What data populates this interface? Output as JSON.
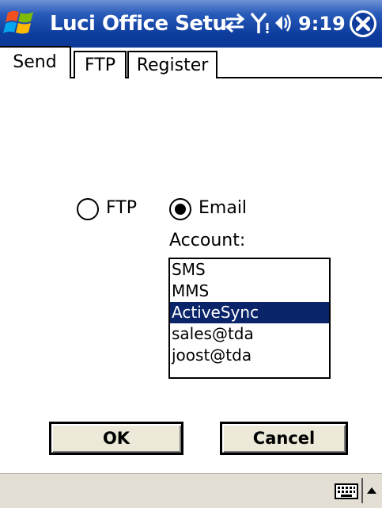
{
  "titlebar": {
    "title": "Luci Office Setu",
    "time": "9:19"
  },
  "icons": {
    "start": "windows-flag-icon",
    "connectivity": "sync-arrows-icon",
    "signal": "signal-antenna-icon",
    "volume": "speaker-icon",
    "close": "close-icon",
    "keyboard": "keyboard-icon",
    "sip": "up-arrow-icon"
  },
  "tabs": [
    {
      "label": "Send",
      "active": true
    },
    {
      "label": "FTP",
      "active": false
    },
    {
      "label": "Register",
      "active": false
    }
  ],
  "mode": {
    "options": [
      {
        "label": "FTP",
        "selected": false
      },
      {
        "label": "Email",
        "selected": true
      }
    ]
  },
  "account": {
    "label": "Account:",
    "items": [
      "SMS",
      "MMS",
      "ActiveSync",
      "sales@tda",
      "joost@tda"
    ],
    "selected": "ActiveSync"
  },
  "buttons": {
    "ok": "OK",
    "cancel": "Cancel"
  },
  "colors": {
    "titlebar": "#0d3c9d",
    "selection": "#0a246a",
    "button_face": "#ece9d8",
    "bottombar": "#e3dfd5"
  }
}
